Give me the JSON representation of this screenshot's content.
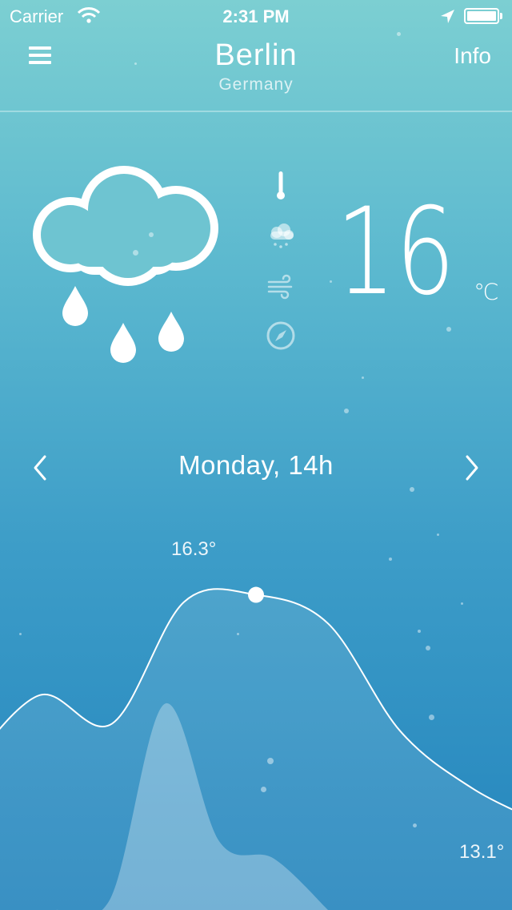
{
  "status_bar": {
    "carrier": "Carrier",
    "time": "2:31 PM"
  },
  "header": {
    "city": "Berlin",
    "country": "Germany",
    "info_label": "Info"
  },
  "current": {
    "condition_icon": "rain-cloud-icon",
    "temperature": "16",
    "unit": "℃",
    "indicator_icons": [
      "thermometer-icon",
      "precipitation-icon",
      "wind-icon",
      "compass-icon"
    ]
  },
  "day_nav": {
    "label": "Monday, 14h"
  },
  "chart_data": {
    "type": "area",
    "series": [
      {
        "values": [
          13.9,
          14.9,
          14.5,
          16.2,
          16.3,
          15.9,
          14.4,
          13.6,
          13.1
        ]
      },
      {
        "values": [
          0,
          0.2,
          3.6,
          1.2,
          0.9,
          0
        ]
      }
    ],
    "max_label": "16.3°",
    "min_label": "13.1°",
    "selected_index": 4
  },
  "colors": {
    "gradient_top": "#7ccfd2",
    "gradient_bottom": "#2384bd"
  }
}
